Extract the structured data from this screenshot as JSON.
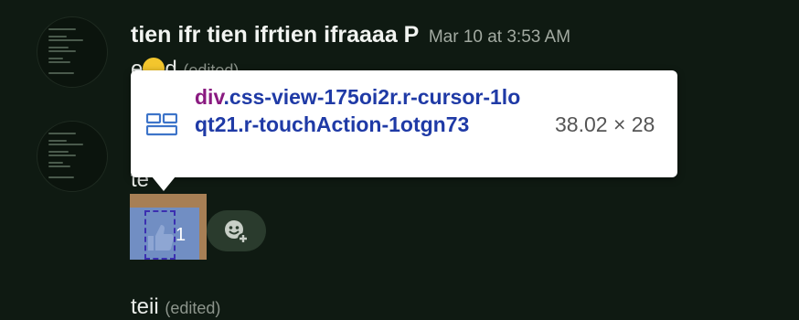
{
  "messages": [
    {
      "author": "tien ifr tien ifrtien ifraaaa P",
      "timestamp": "Mar 10 at 3:53 AM",
      "text_prefix": "e",
      "text_suffix": "d",
      "edited": "(edited)"
    },
    {
      "text": "te"
    },
    {
      "text": "teii",
      "edited": "(edited)"
    }
  ],
  "inspector_tooltip": {
    "tag": "div",
    "classes": ".css-view-175oi2r.r-cursor-1loqt21.r-touchAction-1otgn73",
    "size": "38.02 × 28"
  },
  "reaction": {
    "emoji": "thumbs-up",
    "count": "1"
  },
  "colors": {
    "background": "#0f1a12",
    "tooltip_tag": "#8a1a80",
    "tooltip_classes": "#1f3aa6"
  }
}
